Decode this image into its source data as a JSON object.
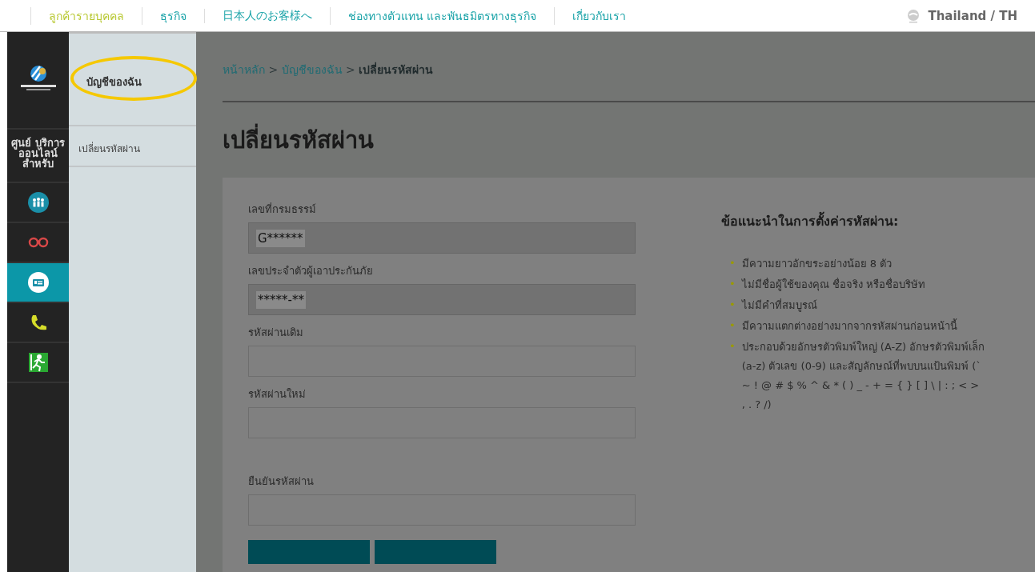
{
  "top_nav": {
    "items": [
      {
        "label": "ลูกค้ารายบุคคล",
        "selected": true
      },
      {
        "label": "ธุรกิจ",
        "selected": false
      },
      {
        "label": "日本人のお客様へ",
        "selected": false
      },
      {
        "label": "ช่องทางตัวแทน และพันธมิตรทางธุรกิจ",
        "selected": false
      },
      {
        "label": "เกี่ยวกับเรา",
        "selected": false
      }
    ],
    "region": "Thailand / TH"
  },
  "rail": {
    "title": "ศูนย์ บริการ ออนไลน์ สำหรับ",
    "items": [
      {
        "kind": "people",
        "selected": false
      },
      {
        "kind": "glasses",
        "selected": false
      },
      {
        "kind": "card",
        "selected": true
      },
      {
        "kind": "phone",
        "selected": false
      },
      {
        "kind": "exit",
        "selected": false
      }
    ]
  },
  "submenu": {
    "heading": "บัญชีของฉัน",
    "items": [
      {
        "label": "เปลี่ยนรหัสผ่าน",
        "selected": false
      }
    ]
  },
  "breadcrumb": [
    {
      "label": "หน้าหลัก",
      "kind": "link"
    },
    {
      "label": ">",
      "kind": "separator"
    },
    {
      "label": "บัญชีของฉัน",
      "kind": "link"
    },
    {
      "label": ">",
      "kind": "separator"
    },
    {
      "label": "เปลี่ยนรหัสผ่าน",
      "kind": "current"
    }
  ],
  "page_title": "เปลี่ยนรหัสผ่าน",
  "form": {
    "fields": [
      {
        "label": "เลขที่กรมธรรม์",
        "value": "G******",
        "disabled": true
      },
      {
        "label": "เลขประจำตัวผู้เอาประกันภัย",
        "value": "*****-**",
        "disabled": true
      },
      {
        "label": "รหัสผ่านเดิม",
        "disabled": false
      },
      {
        "label": "รหัสผ่านใหม่",
        "disabled": false
      },
      {
        "label": "ยืนยันรหัสผ่าน",
        "disabled": false
      }
    ]
  },
  "tips": {
    "heading": "ข้อแนะนำในการตั้งค่ารหัสผ่าน:",
    "bullet": "•",
    "items": [
      "มีความยาวอักขระอย่างน้อย 8 ตัว",
      "ไม่มีชื่อผู้ใช้ของคุณ ชื่อจริง หรือชื่อบริษัท",
      "ไม่มีคำที่สมบูรณ์",
      "มีความแตกต่างอย่างมากจากรหัสผ่านก่อนหน้านี้",
      "ประกอบด้วยอักษรตัวพิมพ์ใหญ่ (A-Z) อักษรตัวพิมพ์เล็ก (a-z) ตัวเลข (0-9) และสัญลักษณ์ที่พบบนแป้นพิมพ์ (` ~ ! @ # $ % ^ & * ( ) _ - + = { } [ ] \\ | : ; < > , . ? /)"
    ]
  }
}
